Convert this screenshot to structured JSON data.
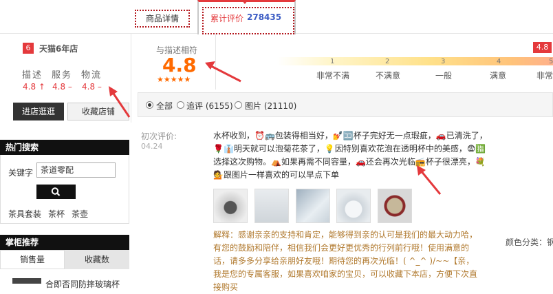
{
  "tabs": {
    "details_label": "商品详情",
    "reviews_label": "累计评价",
    "reviews_count": "278435"
  },
  "shop": {
    "badge": "6",
    "name": "天猫6年店",
    "dsr": [
      {
        "label": "描述",
        "value": "4.8 ↑"
      },
      {
        "label": "服务",
        "value": "4.8 –"
      },
      {
        "label": "物流",
        "value": "4.8 –"
      }
    ],
    "visit_button": "进店逛逛",
    "favorite_button": "收藏店铺"
  },
  "hot_search": {
    "title": "热门搜索",
    "keyword_label": "关键字",
    "keyword_value": "茶道零配",
    "links": [
      "茶具套装",
      "茶杯",
      "茶壶"
    ]
  },
  "boss_recommend": {
    "title": "掌柜推荐",
    "sort_sales": "销售量",
    "sort_favorites": "收藏数",
    "partial_text": "合即否同防摔玻璃杯"
  },
  "rating": {
    "caption": "与描述相符",
    "score": "4.8",
    "stars": "★★★★★",
    "flag": "4.8",
    "scale": [
      {
        "num": "1",
        "label": "非常不满"
      },
      {
        "num": "2",
        "label": "不满意"
      },
      {
        "num": "3",
        "label": "一般"
      },
      {
        "num": "4",
        "label": "满意"
      },
      {
        "num": "5",
        "label": "非常"
      }
    ]
  },
  "filters": {
    "all": "全部",
    "appended": "追评 (6155)",
    "pictures": "图片 (21110)"
  },
  "review": {
    "first_label": "初次评价:",
    "date": "04.24",
    "text": "水杯收到，⏰🚌包装得相当好，💅🈁杯子完好无一点瑕疵，🚗已清洗了，🌹👔明天就可以泡菊花茶了，💡因特别喜欢花泡在透明杯中的美感，😨🈯选择这次购物。⛺如果再需不同容量，🚗还会再次光临📻杯子很漂亮，💐💁跟图片一样喜欢的可以早点下单",
    "reply": "解释：感谢亲亲的支持和肯定，能够得到亲的认可是我们的最大动力哈，有您的鼓励和陪伴，相信我们会更好更优秀的行列前行哦！使用满意的话，请多多分享给亲朋好友哦！期待您的再次光临！( ^_^ )/~~【亲，我是您的专属客服，如果喜欢咱家的宝贝，可以收藏下本店，方便下次直接购买",
    "color_category": "颜色分类：钢"
  },
  "colors": {
    "accent": "#e4393c",
    "score_orange": "#ff6a00",
    "link_blue": "#3c5cc4"
  }
}
